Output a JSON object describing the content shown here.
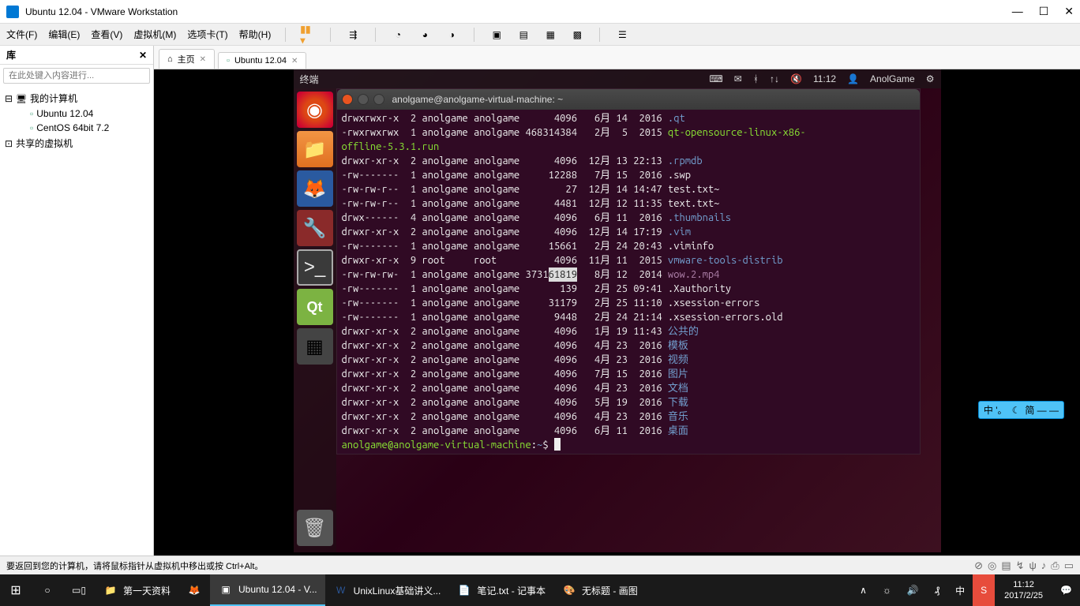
{
  "window": {
    "title": "Ubuntu 12.04 - VMware Workstation"
  },
  "menu": {
    "file": "文件(F)",
    "edit": "编辑(E)",
    "view": "查看(V)",
    "vm": "虚拟机(M)",
    "tabs": "选项卡(T)",
    "help": "帮助(H)"
  },
  "library": {
    "title": "库",
    "search_placeholder": "在此处键入内容进行...",
    "my_computer": "我的计算机",
    "vm1": "Ubuntu 12.04",
    "vm2": "CentOS 64bit 7.2",
    "shared": "共享的虚拟机"
  },
  "tabs": {
    "home": "主页",
    "ubuntu": "Ubuntu 12.04"
  },
  "ubuntu": {
    "topbar_app": "终端",
    "time": "11:12",
    "user": "AnolGame"
  },
  "terminal": {
    "title": "anolgame@anolgame-virtual-machine: ~",
    "prompt": "anolgame@anolgame-virtual-machine",
    "prompt_path": "~",
    "prompt_suffix": "$",
    "lines": [
      {
        "perm": "drwxrwxr-x",
        "n": "2",
        "u": "anolgame",
        "g": "anolgame",
        "size": "4096",
        "mon": "6月",
        "day": "14",
        "time": "2016",
        "name": ".qt",
        "cls": "c-blue"
      },
      {
        "perm": "-rwxrwxrwx",
        "n": "1",
        "u": "anolgame",
        "g": "anolgame",
        "size": "468314384",
        "mon": "2月",
        "day": "5",
        "time": "2015",
        "name": "qt-opensource-linux-x86-",
        "cls": "c-green",
        "wrap": "offline-5.3.1.run"
      },
      {
        "perm": "drwxr-xr-x",
        "n": "2",
        "u": "anolgame",
        "g": "anolgame",
        "size": "4096",
        "mon": "12月",
        "day": "13",
        "time": "22:13",
        "name": ".rpmdb",
        "cls": "c-blue"
      },
      {
        "perm": "-rw-------",
        "n": "1",
        "u": "anolgame",
        "g": "anolgame",
        "size": "12288",
        "mon": "7月",
        "day": "15",
        "time": "2016",
        "name": ".swp",
        "cls": "c-white"
      },
      {
        "perm": "-rw-rw-r--",
        "n": "1",
        "u": "anolgame",
        "g": "anolgame",
        "size": "27",
        "mon": "12月",
        "day": "14",
        "time": "14:47",
        "name": "test.txt~",
        "cls": "c-white"
      },
      {
        "perm": "-rw-rw-r--",
        "n": "1",
        "u": "anolgame",
        "g": "anolgame",
        "size": "4481",
        "mon": "12月",
        "day": "12",
        "time": "11:35",
        "name": "text.txt~",
        "cls": "c-white"
      },
      {
        "perm": "drwx------",
        "n": "4",
        "u": "anolgame",
        "g": "anolgame",
        "size": "4096",
        "mon": "6月",
        "day": "11",
        "time": "2016",
        "name": ".thumbnails",
        "cls": "c-blue"
      },
      {
        "perm": "drwxr-xr-x",
        "n": "2",
        "u": "anolgame",
        "g": "anolgame",
        "size": "4096",
        "mon": "12月",
        "day": "14",
        "time": "17:19",
        "name": ".vim",
        "cls": "c-blue"
      },
      {
        "perm": "-rw-------",
        "n": "1",
        "u": "anolgame",
        "g": "anolgame",
        "size": "15661",
        "mon": "2月",
        "day": "24",
        "time": "20:43",
        "name": ".viminfo",
        "cls": "c-white"
      },
      {
        "perm": "drwxr-xr-x",
        "n": "9",
        "u": "root",
        "g": "root",
        "size": "4096",
        "mon": "11月",
        "day": "11",
        "time": "2015",
        "name": "vmware-tools-distrib",
        "cls": "c-blue"
      },
      {
        "perm": "-rw-rw-rw-",
        "n": "1",
        "u": "anolgame",
        "g": "anolgame",
        "size": "3731",
        "size_sel": "61819",
        "mon": "8月",
        "day": "12",
        "time": "2014",
        "name": "wow.2.mp4",
        "cls": "c-pink"
      },
      {
        "perm": "-rw-------",
        "n": "1",
        "u": "anolgame",
        "g": "anolgame",
        "size": "139",
        "mon": "2月",
        "day": "25",
        "time": "09:41",
        "name": ".Xauthority",
        "cls": "c-white"
      },
      {
        "perm": "-rw-------",
        "n": "1",
        "u": "anolgame",
        "g": "anolgame",
        "size": "31179",
        "mon": "2月",
        "day": "25",
        "time": "11:10",
        "name": ".xsession-errors",
        "cls": "c-white"
      },
      {
        "perm": "-rw-------",
        "n": "1",
        "u": "anolgame",
        "g": "anolgame",
        "size": "9448",
        "mon": "2月",
        "day": "24",
        "time": "21:14",
        "name": ".xsession-errors.old",
        "cls": "c-white"
      },
      {
        "perm": "drwxr-xr-x",
        "n": "2",
        "u": "anolgame",
        "g": "anolgame",
        "size": "4096",
        "mon": "1月",
        "day": "19",
        "time": "11:43",
        "name": "公共的",
        "cls": "c-blue"
      },
      {
        "perm": "drwxr-xr-x",
        "n": "2",
        "u": "anolgame",
        "g": "anolgame",
        "size": "4096",
        "mon": "4月",
        "day": "23",
        "time": "2016",
        "name": "模板",
        "cls": "c-blue"
      },
      {
        "perm": "drwxr-xr-x",
        "n": "2",
        "u": "anolgame",
        "g": "anolgame",
        "size": "4096",
        "mon": "4月",
        "day": "23",
        "time": "2016",
        "name": "视频",
        "cls": "c-blue"
      },
      {
        "perm": "drwxr-xr-x",
        "n": "2",
        "u": "anolgame",
        "g": "anolgame",
        "size": "4096",
        "mon": "7月",
        "day": "15",
        "time": "2016",
        "name": "图片",
        "cls": "c-blue"
      },
      {
        "perm": "drwxr-xr-x",
        "n": "2",
        "u": "anolgame",
        "g": "anolgame",
        "size": "4096",
        "mon": "4月",
        "day": "23",
        "time": "2016",
        "name": "文档",
        "cls": "c-blue"
      },
      {
        "perm": "drwxr-xr-x",
        "n": "2",
        "u": "anolgame",
        "g": "anolgame",
        "size": "4096",
        "mon": "5月",
        "day": "19",
        "time": "2016",
        "name": "下载",
        "cls": "c-blue"
      },
      {
        "perm": "drwxr-xr-x",
        "n": "2",
        "u": "anolgame",
        "g": "anolgame",
        "size": "4096",
        "mon": "4月",
        "day": "23",
        "time": "2016",
        "name": "音乐",
        "cls": "c-blue"
      },
      {
        "perm": "drwxr-xr-x",
        "n": "2",
        "u": "anolgame",
        "g": "anolgame",
        "size": "4096",
        "mon": "6月",
        "day": "11",
        "time": "2016",
        "name": "桌面",
        "cls": "c-blue"
      }
    ]
  },
  "ime": {
    "left": "中 '。",
    "right": "简 — —"
  },
  "statusbar": {
    "hint": "要返回到您的计算机，请将鼠标指针从虚拟机中移出或按 Ctrl+Alt。"
  },
  "taskbar": {
    "folder": "第一天资料",
    "vmware": "Ubuntu 12.04 - V...",
    "word": "UnixLinux基础讲义...",
    "notepad": "笔记.txt - 记事本",
    "paint": "无标题 - 画图",
    "time": "11:12",
    "date": "2017/2/25"
  }
}
